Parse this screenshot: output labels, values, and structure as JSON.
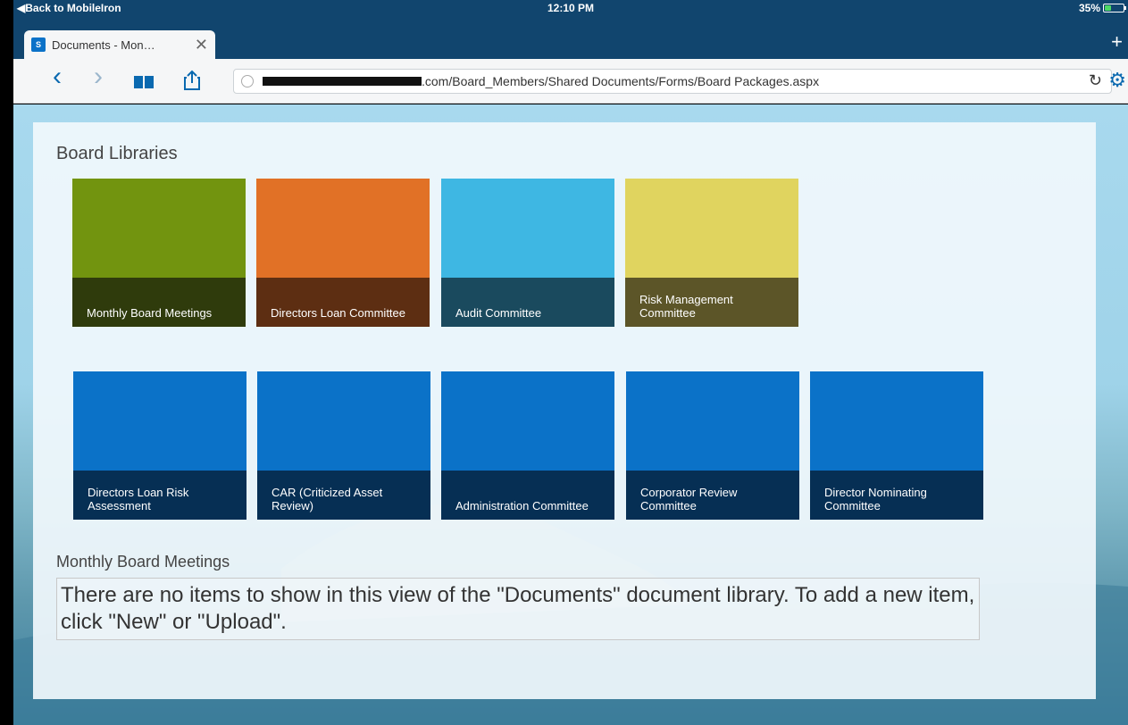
{
  "status_bar": {
    "back_label": "◀Back to MobileIron",
    "time": "12:10 PM",
    "battery": "35%",
    "battery_level": 0.35
  },
  "browser": {
    "tab_title": "Documents - Mon…",
    "tab_close": "✕",
    "new_tab": "+",
    "back_icon": "‹",
    "forward_icon": "›",
    "url_visible": ".com/Board_Members/Shared Documents/Forms/Board Packages.aspx",
    "reload_icon": "↻",
    "settings_icon": "⚙"
  },
  "page": {
    "library_heading": "Board Libraries",
    "tiles": [
      {
        "label": "Monthly Board Meetings",
        "top_color": "#72940f",
        "band_color": "#2f3b0c"
      },
      {
        "label": "Directors Loan Committee",
        "top_color": "#e17126",
        "band_color": "#5d2e12"
      },
      {
        "label": "Audit Committee",
        "top_color": "#3eb7e3",
        "band_color": "#1a4a5e"
      },
      {
        "label": "Risk Management Committee",
        "top_color": "#e0d45f",
        "band_color": "#5c5528"
      },
      {
        "label": "Directors Loan Risk Assessment",
        "top_color": "#0b72c8",
        "band_color": "#062f54"
      },
      {
        "label": "CAR (Criticized Asset Review)",
        "top_color": "#0b72c8",
        "band_color": "#062f54"
      },
      {
        "label": "Administration Committee",
        "top_color": "#0b72c8",
        "band_color": "#062f54"
      },
      {
        "label": "Corporator Review Committee",
        "top_color": "#0b72c8",
        "band_color": "#062f54"
      },
      {
        "label": "Director Nominating Committee",
        "top_color": "#0b72c8",
        "band_color": "#062f54"
      }
    ],
    "section_heading": "Monthly Board Meetings",
    "empty_message": "There are no items to show in this view of the \"Documents\" document library. To add a new item, click \"New\" or \"Upload\"."
  }
}
